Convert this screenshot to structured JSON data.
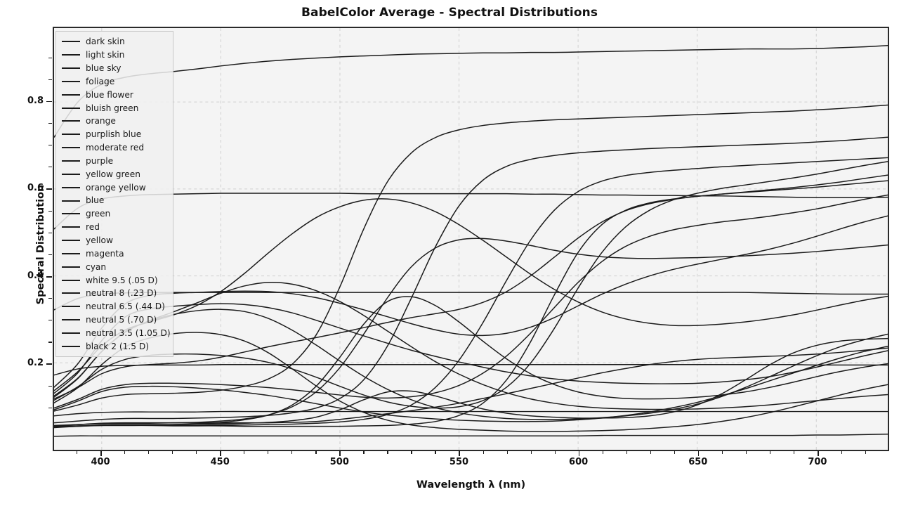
{
  "chart_data": {
    "type": "line",
    "title": "BabelColor Average - Spectral Distributions",
    "xlabel": "Wavelength λ (nm)",
    "ylabel": "Spectral Distribution",
    "xlim": [
      380,
      730
    ],
    "ylim": [
      0.0,
      0.97
    ],
    "grid": true,
    "legend_position": "upper left",
    "xticks": [
      400,
      450,
      500,
      550,
      600,
      650,
      700
    ],
    "xticks_minor": [
      390,
      410,
      420,
      430,
      440,
      460,
      470,
      480,
      490,
      510,
      520,
      530,
      540,
      560,
      570,
      580,
      590,
      610,
      620,
      630,
      640,
      660,
      670,
      680,
      690,
      710,
      720
    ],
    "yticks": [
      0.2,
      0.4,
      0.6,
      0.8
    ],
    "yticks_minor": [
      0.1,
      0.15,
      0.25,
      0.3,
      0.35,
      0.45,
      0.5,
      0.55,
      0.65,
      0.7,
      0.75,
      0.85,
      0.9
    ],
    "line_color": "#1b1b1b",
    "plot_background": "#f4f4f4",
    "grid_color": "#d0d0d0",
    "x": [
      380,
      390,
      400,
      410,
      420,
      430,
      440,
      450,
      460,
      470,
      480,
      490,
      500,
      510,
      520,
      530,
      540,
      550,
      560,
      570,
      580,
      590,
      600,
      610,
      620,
      630,
      640,
      650,
      660,
      670,
      680,
      690,
      700,
      710,
      720,
      730
    ],
    "series": [
      {
        "name": "dark skin",
        "values": [
          0.055,
          0.058,
          0.061,
          0.062,
          0.062,
          0.062,
          0.062,
          0.062,
          0.062,
          0.062,
          0.063,
          0.065,
          0.07,
          0.076,
          0.083,
          0.09,
          0.098,
          0.107,
          0.118,
          0.129,
          0.141,
          0.153,
          0.165,
          0.177,
          0.187,
          0.196,
          0.203,
          0.208,
          0.211,
          0.213,
          0.215,
          0.217,
          0.22,
          0.224,
          0.229,
          0.234
        ]
      },
      {
        "name": "light skin",
        "values": [
          0.117,
          0.143,
          0.175,
          0.191,
          0.196,
          0.199,
          0.204,
          0.213,
          0.225,
          0.237,
          0.248,
          0.258,
          0.269,
          0.281,
          0.293,
          0.304,
          0.313,
          0.323,
          0.339,
          0.364,
          0.4,
          0.443,
          0.487,
          0.524,
          0.55,
          0.566,
          0.576,
          0.583,
          0.588,
          0.593,
          0.598,
          0.603,
          0.609,
          0.616,
          0.624,
          0.632
        ]
      },
      {
        "name": "blue sky",
        "values": [
          0.13,
          0.177,
          0.251,
          0.306,
          0.324,
          0.33,
          0.334,
          0.336,
          0.334,
          0.327,
          0.315,
          0.298,
          0.28,
          0.262,
          0.245,
          0.229,
          0.215,
          0.202,
          0.19,
          0.179,
          0.17,
          0.163,
          0.158,
          0.155,
          0.153,
          0.152,
          0.152,
          0.153,
          0.156,
          0.161,
          0.168,
          0.178,
          0.19,
          0.203,
          0.216,
          0.228
        ]
      },
      {
        "name": "foliage",
        "values": [
          0.051,
          0.054,
          0.057,
          0.058,
          0.058,
          0.058,
          0.059,
          0.06,
          0.061,
          0.063,
          0.067,
          0.075,
          0.092,
          0.115,
          0.133,
          0.135,
          0.124,
          0.108,
          0.094,
          0.084,
          0.078,
          0.075,
          0.073,
          0.073,
          0.074,
          0.078,
          0.087,
          0.103,
          0.128,
          0.16,
          0.194,
          0.222,
          0.24,
          0.25,
          0.254,
          0.256
        ]
      },
      {
        "name": "blue flower",
        "values": [
          0.144,
          0.198,
          0.28,
          0.336,
          0.355,
          0.36,
          0.362,
          0.364,
          0.365,
          0.364,
          0.359,
          0.35,
          0.337,
          0.322,
          0.306,
          0.29,
          0.276,
          0.266,
          0.263,
          0.268,
          0.282,
          0.304,
          0.331,
          0.358,
          0.381,
          0.4,
          0.415,
          0.427,
          0.438,
          0.449,
          0.461,
          0.475,
          0.491,
          0.508,
          0.524,
          0.538
        ]
      },
      {
        "name": "bluish green",
        "values": [
          0.136,
          0.18,
          0.239,
          0.276,
          0.294,
          0.31,
          0.332,
          0.364,
          0.406,
          0.453,
          0.497,
          0.534,
          0.559,
          0.574,
          0.577,
          0.568,
          0.548,
          0.518,
          0.482,
          0.443,
          0.404,
          0.369,
          0.34,
          0.317,
          0.301,
          0.291,
          0.286,
          0.286,
          0.289,
          0.294,
          0.301,
          0.31,
          0.321,
          0.333,
          0.344,
          0.353
        ]
      },
      {
        "name": "orange",
        "values": [
          0.054,
          0.055,
          0.056,
          0.056,
          0.056,
          0.056,
          0.056,
          0.057,
          0.057,
          0.058,
          0.059,
          0.061,
          0.064,
          0.07,
          0.081,
          0.103,
          0.143,
          0.206,
          0.292,
          0.39,
          0.482,
          0.551,
          0.594,
          0.618,
          0.631,
          0.638,
          0.643,
          0.647,
          0.651,
          0.654,
          0.657,
          0.66,
          0.663,
          0.666,
          0.669,
          0.672
        ]
      },
      {
        "name": "purplish blue",
        "values": [
          0.124,
          0.165,
          0.226,
          0.272,
          0.296,
          0.311,
          0.32,
          0.323,
          0.318,
          0.302,
          0.275,
          0.241,
          0.204,
          0.169,
          0.139,
          0.115,
          0.097,
          0.085,
          0.077,
          0.072,
          0.07,
          0.07,
          0.071,
          0.074,
          0.078,
          0.084,
          0.093,
          0.105,
          0.122,
          0.143,
          0.167,
          0.192,
          0.216,
          0.237,
          0.253,
          0.266
        ]
      },
      {
        "name": "moderate red",
        "values": [
          0.096,
          0.116,
          0.139,
          0.15,
          0.153,
          0.153,
          0.152,
          0.15,
          0.147,
          0.143,
          0.138,
          0.132,
          0.126,
          0.121,
          0.119,
          0.122,
          0.131,
          0.148,
          0.176,
          0.216,
          0.268,
          0.327,
          0.385,
          0.433,
          0.468,
          0.491,
          0.506,
          0.516,
          0.524,
          0.53,
          0.537,
          0.545,
          0.554,
          0.565,
          0.576,
          0.586
        ]
      },
      {
        "name": "purple",
        "values": [
          0.092,
          0.112,
          0.134,
          0.144,
          0.146,
          0.145,
          0.142,
          0.138,
          0.132,
          0.125,
          0.116,
          0.106,
          0.096,
          0.087,
          0.08,
          0.075,
          0.071,
          0.068,
          0.066,
          0.065,
          0.065,
          0.066,
          0.069,
          0.073,
          0.079,
          0.087,
          0.097,
          0.109,
          0.124,
          0.14,
          0.158,
          0.176,
          0.194,
          0.211,
          0.226,
          0.238
        ]
      },
      {
        "name": "yellow green",
        "values": [
          0.056,
          0.058,
          0.06,
          0.061,
          0.061,
          0.062,
          0.063,
          0.066,
          0.071,
          0.08,
          0.099,
          0.133,
          0.189,
          0.266,
          0.35,
          0.421,
          0.464,
          0.483,
          0.486,
          0.48,
          0.47,
          0.459,
          0.45,
          0.444,
          0.441,
          0.44,
          0.441,
          0.442,
          0.444,
          0.446,
          0.449,
          0.452,
          0.456,
          0.461,
          0.466,
          0.471
        ]
      },
      {
        "name": "orange yellow",
        "values": [
          0.062,
          0.066,
          0.07,
          0.072,
          0.072,
          0.072,
          0.073,
          0.074,
          0.076,
          0.079,
          0.085,
          0.096,
          0.118,
          0.161,
          0.239,
          0.349,
          0.466,
          0.561,
          0.62,
          0.652,
          0.668,
          0.677,
          0.683,
          0.687,
          0.69,
          0.693,
          0.695,
          0.697,
          0.699,
          0.701,
          0.703,
          0.705,
          0.708,
          0.711,
          0.715,
          0.719
        ]
      },
      {
        "name": "blue",
        "values": [
          0.108,
          0.143,
          0.196,
          0.237,
          0.257,
          0.267,
          0.27,
          0.265,
          0.25,
          0.223,
          0.186,
          0.147,
          0.112,
          0.086,
          0.068,
          0.057,
          0.051,
          0.047,
          0.045,
          0.043,
          0.042,
          0.042,
          0.043,
          0.044,
          0.046,
          0.049,
          0.053,
          0.058,
          0.065,
          0.074,
          0.085,
          0.098,
          0.112,
          0.126,
          0.139,
          0.15
        ]
      },
      {
        "name": "green",
        "values": [
          0.052,
          0.054,
          0.056,
          0.057,
          0.057,
          0.058,
          0.06,
          0.063,
          0.069,
          0.08,
          0.103,
          0.146,
          0.213,
          0.289,
          0.341,
          0.352,
          0.332,
          0.294,
          0.25,
          0.209,
          0.175,
          0.15,
          0.133,
          0.123,
          0.118,
          0.117,
          0.118,
          0.121,
          0.126,
          0.133,
          0.143,
          0.155,
          0.168,
          0.18,
          0.19,
          0.198
        ]
      },
      {
        "name": "red",
        "values": [
          0.054,
          0.055,
          0.056,
          0.056,
          0.056,
          0.055,
          0.055,
          0.055,
          0.054,
          0.054,
          0.054,
          0.054,
          0.054,
          0.055,
          0.056,
          0.059,
          0.065,
          0.079,
          0.107,
          0.161,
          0.248,
          0.356,
          0.454,
          0.518,
          0.551,
          0.568,
          0.577,
          0.583,
          0.588,
          0.592,
          0.596,
          0.6,
          0.604,
          0.609,
          0.614,
          0.619
        ]
      },
      {
        "name": "yellow",
        "values": [
          0.089,
          0.103,
          0.119,
          0.127,
          0.129,
          0.13,
          0.132,
          0.137,
          0.146,
          0.163,
          0.197,
          0.264,
          0.375,
          0.508,
          0.617,
          0.683,
          0.718,
          0.736,
          0.746,
          0.752,
          0.756,
          0.759,
          0.761,
          0.763,
          0.765,
          0.767,
          0.769,
          0.771,
          0.773,
          0.775,
          0.777,
          0.779,
          0.782,
          0.785,
          0.789,
          0.793
        ]
      },
      {
        "name": "magenta",
        "values": [
          0.114,
          0.145,
          0.185,
          0.208,
          0.217,
          0.22,
          0.22,
          0.217,
          0.211,
          0.201,
          0.186,
          0.167,
          0.146,
          0.126,
          0.11,
          0.1,
          0.096,
          0.099,
          0.113,
          0.144,
          0.199,
          0.279,
          0.372,
          0.454,
          0.513,
          0.551,
          0.575,
          0.59,
          0.601,
          0.609,
          0.617,
          0.625,
          0.634,
          0.644,
          0.654,
          0.663
        ]
      },
      {
        "name": "cyan",
        "values": [
          0.121,
          0.164,
          0.226,
          0.271,
          0.297,
          0.317,
          0.338,
          0.36,
          0.377,
          0.385,
          0.381,
          0.366,
          0.341,
          0.309,
          0.273,
          0.237,
          0.203,
          0.174,
          0.15,
          0.131,
          0.117,
          0.107,
          0.1,
          0.096,
          0.094,
          0.093,
          0.093,
          0.094,
          0.096,
          0.099,
          0.103,
          0.108,
          0.113,
          0.118,
          0.123,
          0.127
        ]
      },
      {
        "name": "white 9.5 (.05 D)",
        "values": [
          0.719,
          0.8,
          0.841,
          0.857,
          0.865,
          0.87,
          0.876,
          0.883,
          0.889,
          0.894,
          0.898,
          0.901,
          0.904,
          0.906,
          0.908,
          0.91,
          0.911,
          0.912,
          0.913,
          0.913,
          0.914,
          0.914,
          0.915,
          0.916,
          0.917,
          0.918,
          0.919,
          0.92,
          0.921,
          0.922,
          0.922,
          0.922,
          0.923,
          0.925,
          0.927,
          0.93
        ]
      },
      {
        "name": "neutral 8 (.23 D)",
        "values": [
          0.508,
          0.556,
          0.577,
          0.584,
          0.587,
          0.588,
          0.589,
          0.59,
          0.59,
          0.59,
          0.59,
          0.59,
          0.59,
          0.589,
          0.589,
          0.589,
          0.589,
          0.589,
          0.589,
          0.589,
          0.588,
          0.588,
          0.587,
          0.586,
          0.586,
          0.585,
          0.585,
          0.584,
          0.584,
          0.583,
          0.582,
          0.581,
          0.58,
          0.58,
          0.58,
          0.581
        ]
      },
      {
        "name": "neutral 6.5 (.44 D)",
        "values": [
          0.322,
          0.348,
          0.358,
          0.361,
          0.362,
          0.362,
          0.362,
          0.362,
          0.362,
          0.362,
          0.362,
          0.362,
          0.362,
          0.362,
          0.362,
          0.362,
          0.362,
          0.362,
          0.362,
          0.362,
          0.362,
          0.362,
          0.362,
          0.362,
          0.362,
          0.362,
          0.362,
          0.362,
          0.362,
          0.362,
          0.361,
          0.36,
          0.359,
          0.358,
          0.358,
          0.358
        ]
      },
      {
        "name": "neutral 5 (.70 D)",
        "values": [
          0.172,
          0.186,
          0.192,
          0.194,
          0.195,
          0.195,
          0.195,
          0.196,
          0.196,
          0.196,
          0.196,
          0.196,
          0.196,
          0.196,
          0.196,
          0.196,
          0.196,
          0.196,
          0.196,
          0.196,
          0.196,
          0.196,
          0.196,
          0.196,
          0.196,
          0.196,
          0.196,
          0.196,
          0.196,
          0.196,
          0.196,
          0.196,
          0.195,
          0.195,
          0.195,
          0.195
        ]
      },
      {
        "name": "neutral 3.5 (1.05 D)",
        "values": [
          0.078,
          0.083,
          0.086,
          0.087,
          0.087,
          0.087,
          0.087,
          0.088,
          0.088,
          0.088,
          0.088,
          0.088,
          0.088,
          0.088,
          0.088,
          0.088,
          0.088,
          0.088,
          0.088,
          0.088,
          0.088,
          0.088,
          0.088,
          0.088,
          0.088,
          0.088,
          0.088,
          0.088,
          0.088,
          0.088,
          0.088,
          0.088,
          0.088,
          0.088,
          0.088,
          0.088
        ]
      },
      {
        "name": "black 2 (1.5 D)",
        "values": [
          0.031,
          0.032,
          0.032,
          0.032,
          0.032,
          0.032,
          0.032,
          0.032,
          0.032,
          0.032,
          0.032,
          0.032,
          0.032,
          0.032,
          0.032,
          0.032,
          0.032,
          0.032,
          0.032,
          0.032,
          0.032,
          0.032,
          0.032,
          0.033,
          0.033,
          0.033,
          0.033,
          0.033,
          0.033,
          0.033,
          0.033,
          0.033,
          0.034,
          0.034,
          0.035,
          0.036
        ]
      }
    ]
  }
}
